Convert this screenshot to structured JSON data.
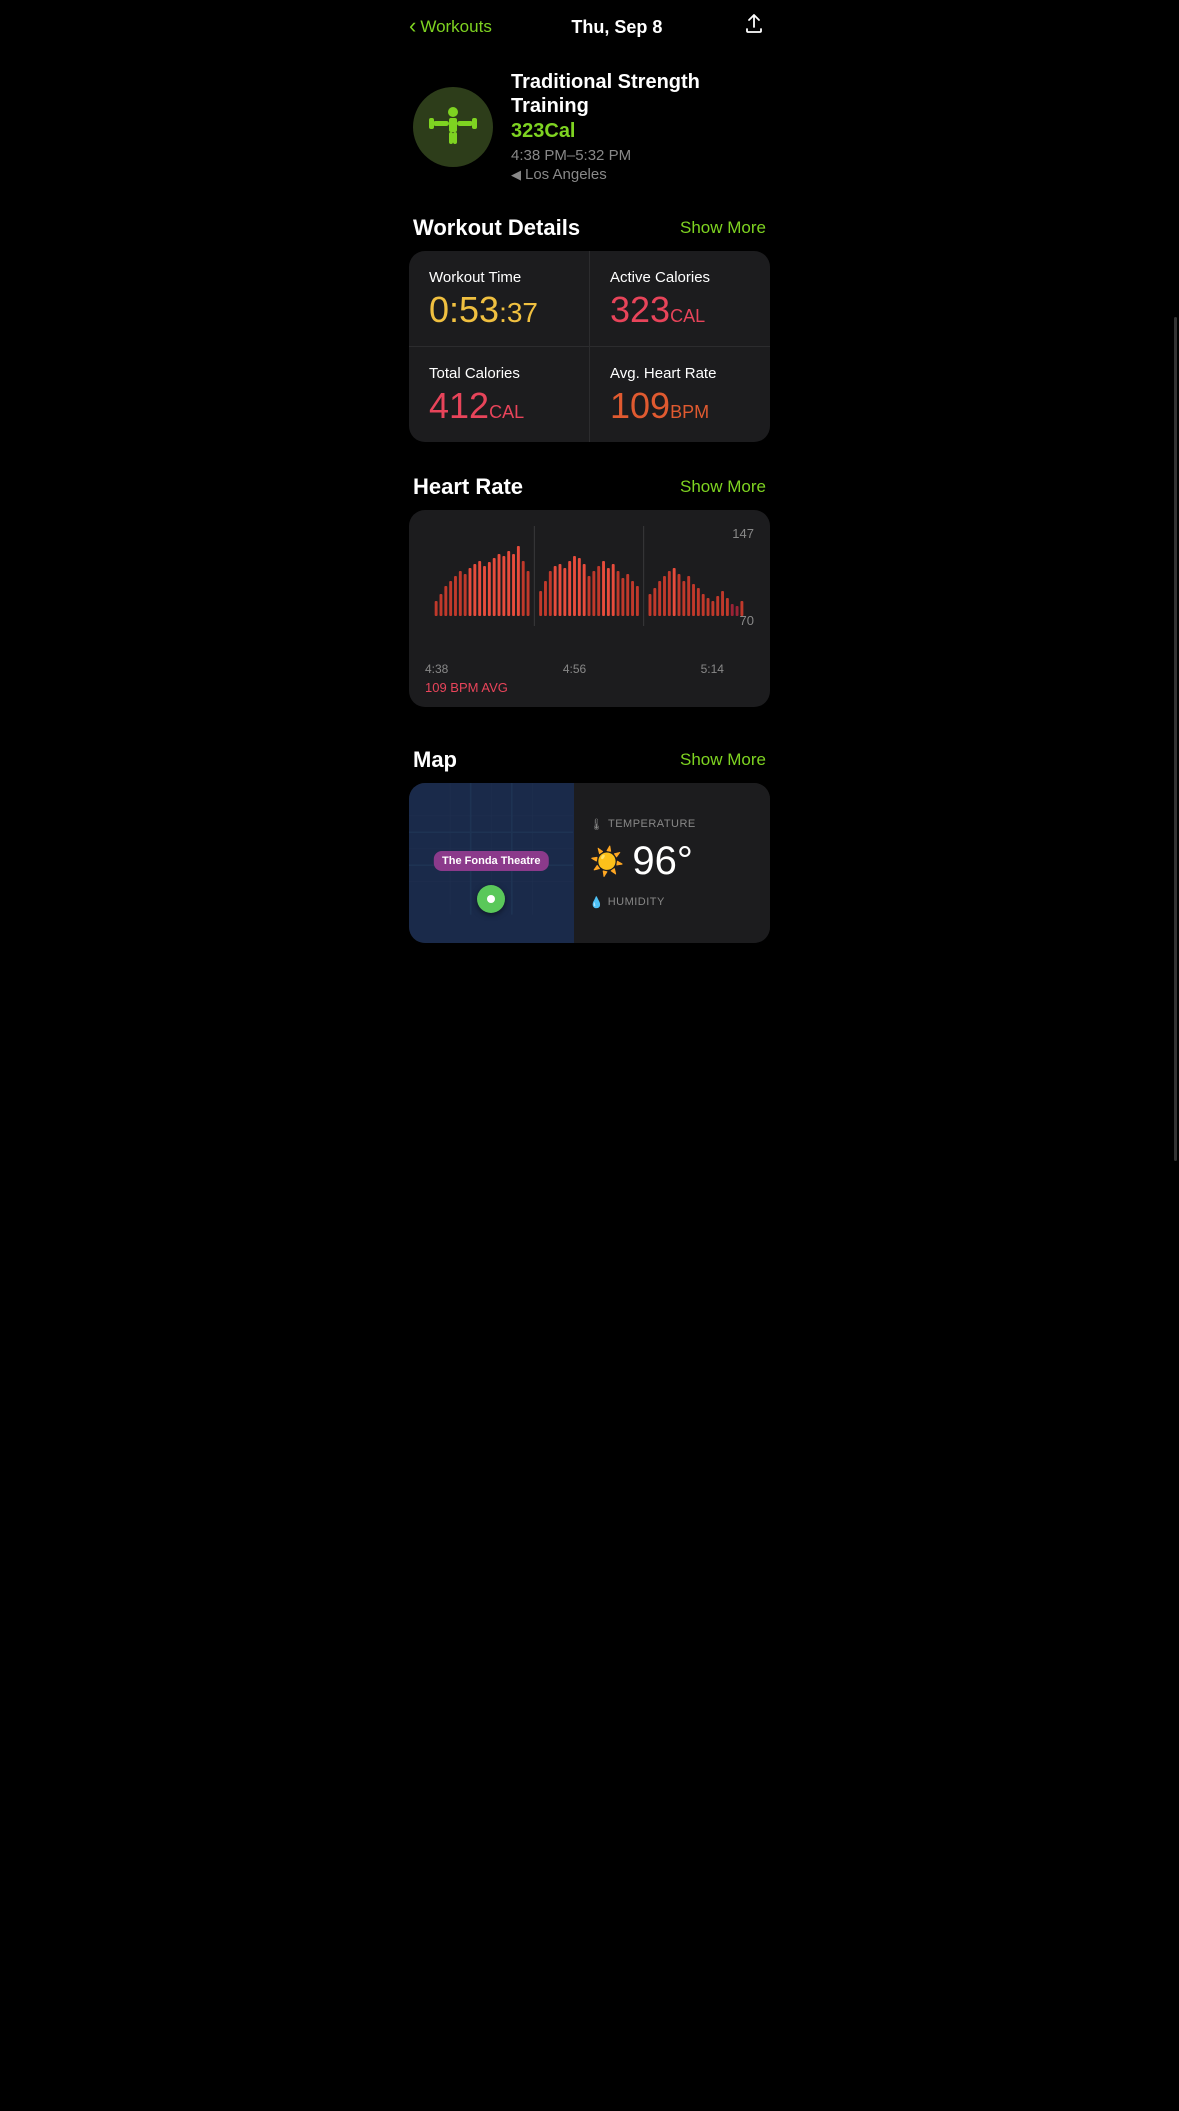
{
  "header": {
    "back_label": "Workouts",
    "title": "Thu, Sep 8",
    "share_icon": "↑"
  },
  "workout": {
    "name": "Traditional Strength Training",
    "calories_active": "323Cal",
    "time_range": "4:38 PM–5:32 PM",
    "location_icon": "◀",
    "location": "Los Angeles"
  },
  "workout_details": {
    "section_title": "Workout Details",
    "show_more": "Show More",
    "workout_time_label": "Workout Time",
    "workout_time_value": "0:53",
    "workout_time_seconds": ":37",
    "active_calories_label": "Active Calories",
    "active_calories_value": "323",
    "active_calories_unit": "CAL",
    "total_calories_label": "Total Calories",
    "total_calories_value": "412",
    "total_calories_unit": "CAL",
    "avg_heart_rate_label": "Avg. Heart Rate",
    "avg_heart_rate_value": "109",
    "avg_heart_rate_unit": "BPM"
  },
  "heart_rate": {
    "section_title": "Heart Rate",
    "show_more": "Show More",
    "max_value": "147",
    "min_value": "70",
    "time_start": "4:38",
    "time_mid1": "4:56",
    "time_mid2": "5:14",
    "avg_label": "109 BPM AVG"
  },
  "map": {
    "section_title": "Map",
    "show_more": "Show More",
    "venue_name": "The Fonda Theatre",
    "weather_label": "TEMPERATURE",
    "temperature": "96°",
    "humidity_label": "HUMIDITY"
  }
}
